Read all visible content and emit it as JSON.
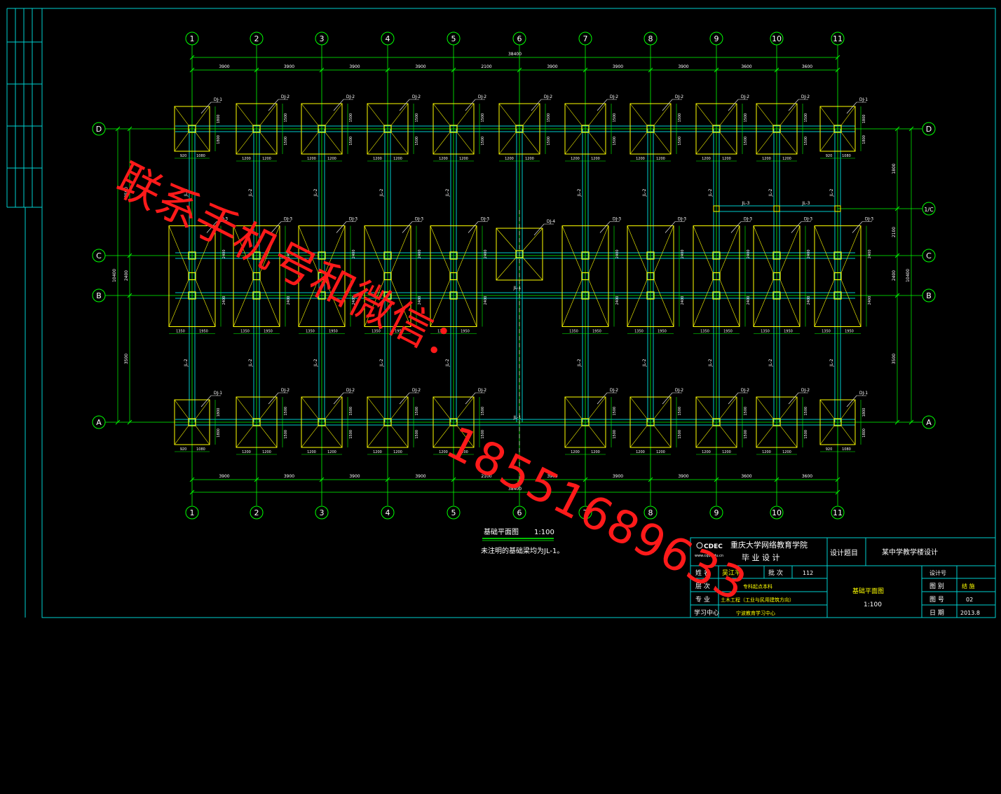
{
  "axes": {
    "columns": [
      "1",
      "2",
      "3",
      "4",
      "5",
      "6",
      "7",
      "8",
      "9",
      "10",
      "11"
    ],
    "rows": [
      {
        "label": "D"
      },
      {
        "label": "1/C"
      },
      {
        "label": "C"
      },
      {
        "label": "B"
      },
      {
        "label": "A"
      }
    ]
  },
  "dimensions": {
    "overall": "38400",
    "spans": [
      "3900",
      "3900",
      "3900",
      "3900",
      "2100",
      "3900",
      "3900",
      "3900",
      "3600",
      "3600"
    ],
    "left_rows": [
      "2500",
      "2400",
      "3500"
    ],
    "left_total": "10400",
    "right_rows": [
      "1800",
      "2100",
      "2400",
      "3500"
    ],
    "right_total": "10400"
  },
  "labels": {
    "footing_dj1": "DJ-1",
    "footing_dj2": "DJ-2",
    "footing_dj3": "DJ-3",
    "footing_dj4": "DJ-4",
    "beam_jl1": "JL-1",
    "beam_jl2": "JL-2",
    "beam_jl3": "JL-3",
    "fd_920": "920",
    "fd_1080": "1080",
    "fd_1200": "1200",
    "fd_1350": "1350",
    "fd_1950": "1950",
    "fd_1500": "1500",
    "fd_1800": "1800",
    "fd_2400": "2400"
  },
  "plan": {
    "title": "基础平面图",
    "scale": "1:100",
    "note": "未注明的基础梁均为JL-1。"
  },
  "title_block": {
    "school": "重庆大学网络教育学院",
    "doc_type": "毕 业 设 计",
    "logo_text": "CDEC",
    "logo_sub": "www.cqu.edu.cn",
    "topic_label": "设计题目",
    "topic": "某中学教学楼设计",
    "name_label": "姓 名",
    "name": "吴江平",
    "batch_label": "批 次",
    "batch": "112",
    "level_label": "层 次",
    "level": "专科起点本科",
    "major_label": "专 业",
    "major": "土木工程（工业与民用建筑方向）",
    "center_label": "学习中心",
    "center": "宁波教育学习中心",
    "drawing_name": "基础平面图",
    "drawing_scale": "1:100",
    "design_no_label": "设计号",
    "category_label": "图 别",
    "category": "结 施",
    "number_label": "图 号",
    "number": "02",
    "date_label": "日 期",
    "date": "2013.8"
  },
  "watermark": {
    "line1": "联系手机号和微信：",
    "line2": "18551689633"
  },
  "colors": {
    "background": "#000000",
    "grid_axis": "#00ff00",
    "footing": "#ffff00",
    "beam": "#00cccc",
    "frame": "#00ffff",
    "text": "#ffffff",
    "watermark": "#ff1a1a"
  }
}
